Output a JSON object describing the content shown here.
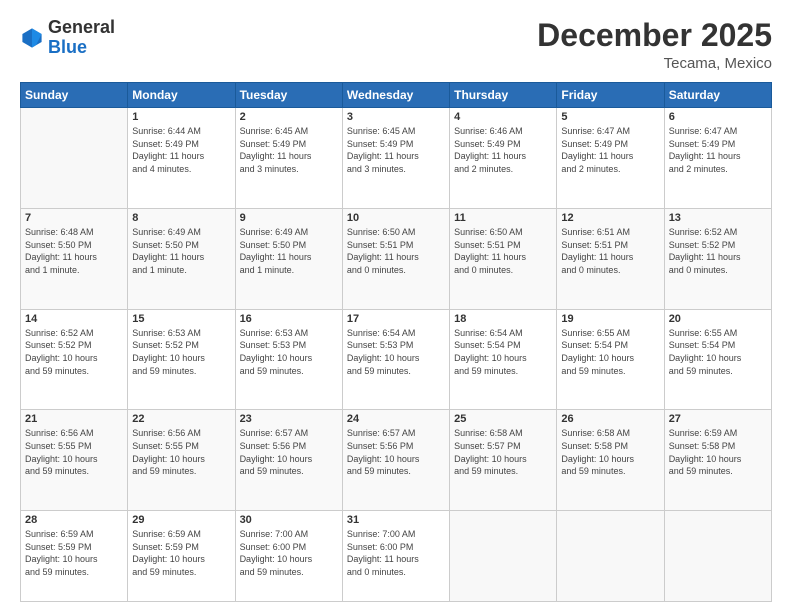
{
  "header": {
    "logo_general": "General",
    "logo_blue": "Blue",
    "month": "December 2025",
    "location": "Tecama, Mexico"
  },
  "days_of_week": [
    "Sunday",
    "Monday",
    "Tuesday",
    "Wednesday",
    "Thursday",
    "Friday",
    "Saturday"
  ],
  "weeks": [
    [
      {
        "day": "",
        "info": ""
      },
      {
        "day": "1",
        "info": "Sunrise: 6:44 AM\nSunset: 5:49 PM\nDaylight: 11 hours\nand 4 minutes."
      },
      {
        "day": "2",
        "info": "Sunrise: 6:45 AM\nSunset: 5:49 PM\nDaylight: 11 hours\nand 3 minutes."
      },
      {
        "day": "3",
        "info": "Sunrise: 6:45 AM\nSunset: 5:49 PM\nDaylight: 11 hours\nand 3 minutes."
      },
      {
        "day": "4",
        "info": "Sunrise: 6:46 AM\nSunset: 5:49 PM\nDaylight: 11 hours\nand 2 minutes."
      },
      {
        "day": "5",
        "info": "Sunrise: 6:47 AM\nSunset: 5:49 PM\nDaylight: 11 hours\nand 2 minutes."
      },
      {
        "day": "6",
        "info": "Sunrise: 6:47 AM\nSunset: 5:49 PM\nDaylight: 11 hours\nand 2 minutes."
      }
    ],
    [
      {
        "day": "7",
        "info": "Sunrise: 6:48 AM\nSunset: 5:50 PM\nDaylight: 11 hours\nand 1 minute."
      },
      {
        "day": "8",
        "info": "Sunrise: 6:49 AM\nSunset: 5:50 PM\nDaylight: 11 hours\nand 1 minute."
      },
      {
        "day": "9",
        "info": "Sunrise: 6:49 AM\nSunset: 5:50 PM\nDaylight: 11 hours\nand 1 minute."
      },
      {
        "day": "10",
        "info": "Sunrise: 6:50 AM\nSunset: 5:51 PM\nDaylight: 11 hours\nand 0 minutes."
      },
      {
        "day": "11",
        "info": "Sunrise: 6:50 AM\nSunset: 5:51 PM\nDaylight: 11 hours\nand 0 minutes."
      },
      {
        "day": "12",
        "info": "Sunrise: 6:51 AM\nSunset: 5:51 PM\nDaylight: 11 hours\nand 0 minutes."
      },
      {
        "day": "13",
        "info": "Sunrise: 6:52 AM\nSunset: 5:52 PM\nDaylight: 11 hours\nand 0 minutes."
      }
    ],
    [
      {
        "day": "14",
        "info": "Sunrise: 6:52 AM\nSunset: 5:52 PM\nDaylight: 10 hours\nand 59 minutes."
      },
      {
        "day": "15",
        "info": "Sunrise: 6:53 AM\nSunset: 5:52 PM\nDaylight: 10 hours\nand 59 minutes."
      },
      {
        "day": "16",
        "info": "Sunrise: 6:53 AM\nSunset: 5:53 PM\nDaylight: 10 hours\nand 59 minutes."
      },
      {
        "day": "17",
        "info": "Sunrise: 6:54 AM\nSunset: 5:53 PM\nDaylight: 10 hours\nand 59 minutes."
      },
      {
        "day": "18",
        "info": "Sunrise: 6:54 AM\nSunset: 5:54 PM\nDaylight: 10 hours\nand 59 minutes."
      },
      {
        "day": "19",
        "info": "Sunrise: 6:55 AM\nSunset: 5:54 PM\nDaylight: 10 hours\nand 59 minutes."
      },
      {
        "day": "20",
        "info": "Sunrise: 6:55 AM\nSunset: 5:54 PM\nDaylight: 10 hours\nand 59 minutes."
      }
    ],
    [
      {
        "day": "21",
        "info": "Sunrise: 6:56 AM\nSunset: 5:55 PM\nDaylight: 10 hours\nand 59 minutes."
      },
      {
        "day": "22",
        "info": "Sunrise: 6:56 AM\nSunset: 5:55 PM\nDaylight: 10 hours\nand 59 minutes."
      },
      {
        "day": "23",
        "info": "Sunrise: 6:57 AM\nSunset: 5:56 PM\nDaylight: 10 hours\nand 59 minutes."
      },
      {
        "day": "24",
        "info": "Sunrise: 6:57 AM\nSunset: 5:56 PM\nDaylight: 10 hours\nand 59 minutes."
      },
      {
        "day": "25",
        "info": "Sunrise: 6:58 AM\nSunset: 5:57 PM\nDaylight: 10 hours\nand 59 minutes."
      },
      {
        "day": "26",
        "info": "Sunrise: 6:58 AM\nSunset: 5:58 PM\nDaylight: 10 hours\nand 59 minutes."
      },
      {
        "day": "27",
        "info": "Sunrise: 6:59 AM\nSunset: 5:58 PM\nDaylight: 10 hours\nand 59 minutes."
      }
    ],
    [
      {
        "day": "28",
        "info": "Sunrise: 6:59 AM\nSunset: 5:59 PM\nDaylight: 10 hours\nand 59 minutes."
      },
      {
        "day": "29",
        "info": "Sunrise: 6:59 AM\nSunset: 5:59 PM\nDaylight: 10 hours\nand 59 minutes."
      },
      {
        "day": "30",
        "info": "Sunrise: 7:00 AM\nSunset: 6:00 PM\nDaylight: 10 hours\nand 59 minutes."
      },
      {
        "day": "31",
        "info": "Sunrise: 7:00 AM\nSunset: 6:00 PM\nDaylight: 11 hours\nand 0 minutes."
      },
      {
        "day": "",
        "info": ""
      },
      {
        "day": "",
        "info": ""
      },
      {
        "day": "",
        "info": ""
      }
    ]
  ]
}
